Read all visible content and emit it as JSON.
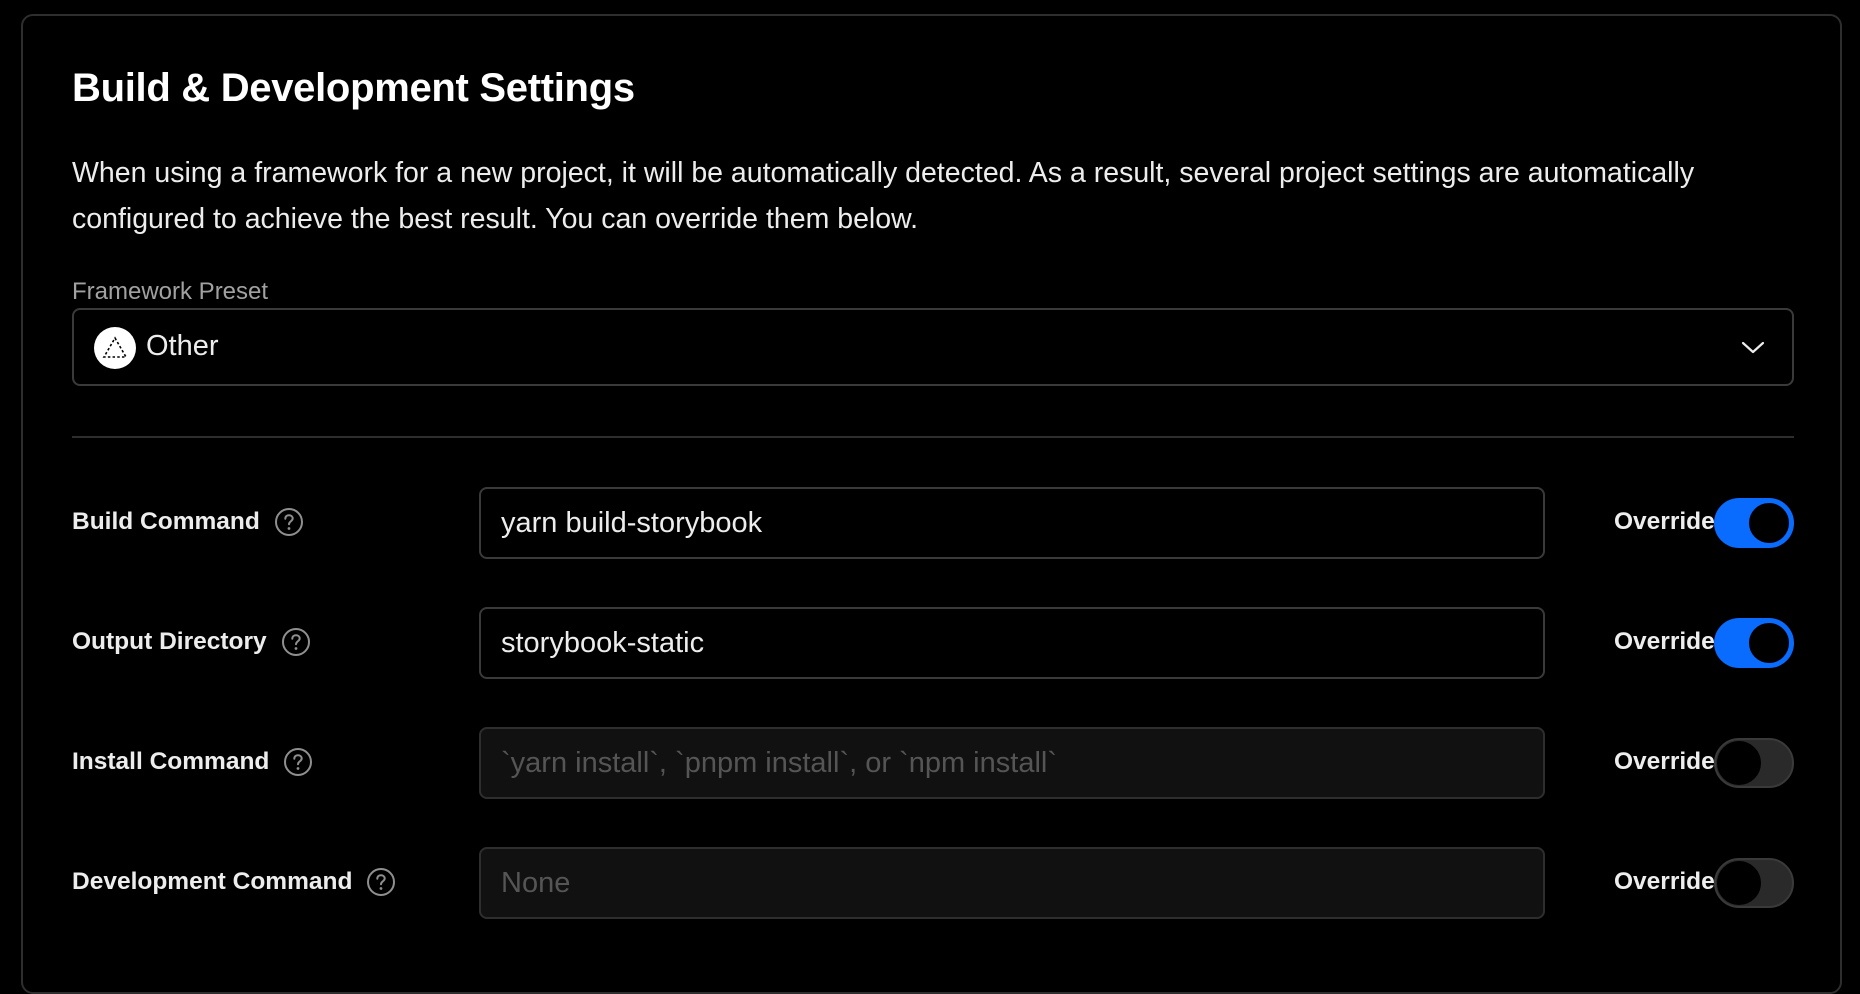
{
  "section": {
    "title": "Build & Development Settings",
    "description": "When using a framework for a new project, it will be automatically detected. As a result, several project settings are automatically configured to achieve the best result. You can override them below."
  },
  "framework_preset": {
    "label": "Framework Preset",
    "selected": "Other",
    "icon": "framework-other-icon"
  },
  "settings": [
    {
      "label": "Build Command",
      "value": "yarn build-storybook",
      "placeholder": "",
      "override_label": "Override",
      "override_enabled": true
    },
    {
      "label": "Output Directory",
      "value": "storybook-static",
      "placeholder": "",
      "override_label": "Override",
      "override_enabled": true
    },
    {
      "label": "Install Command",
      "value": "",
      "placeholder": "`yarn install`, `pnpm install`, or `npm install`",
      "override_label": "Override",
      "override_enabled": false
    },
    {
      "label": "Development Command",
      "value": "",
      "placeholder": "None",
      "override_label": "Override",
      "override_enabled": false
    }
  ],
  "colors": {
    "accent": "#0a6cff",
    "background": "#000000",
    "border": "#3a3a3a"
  }
}
